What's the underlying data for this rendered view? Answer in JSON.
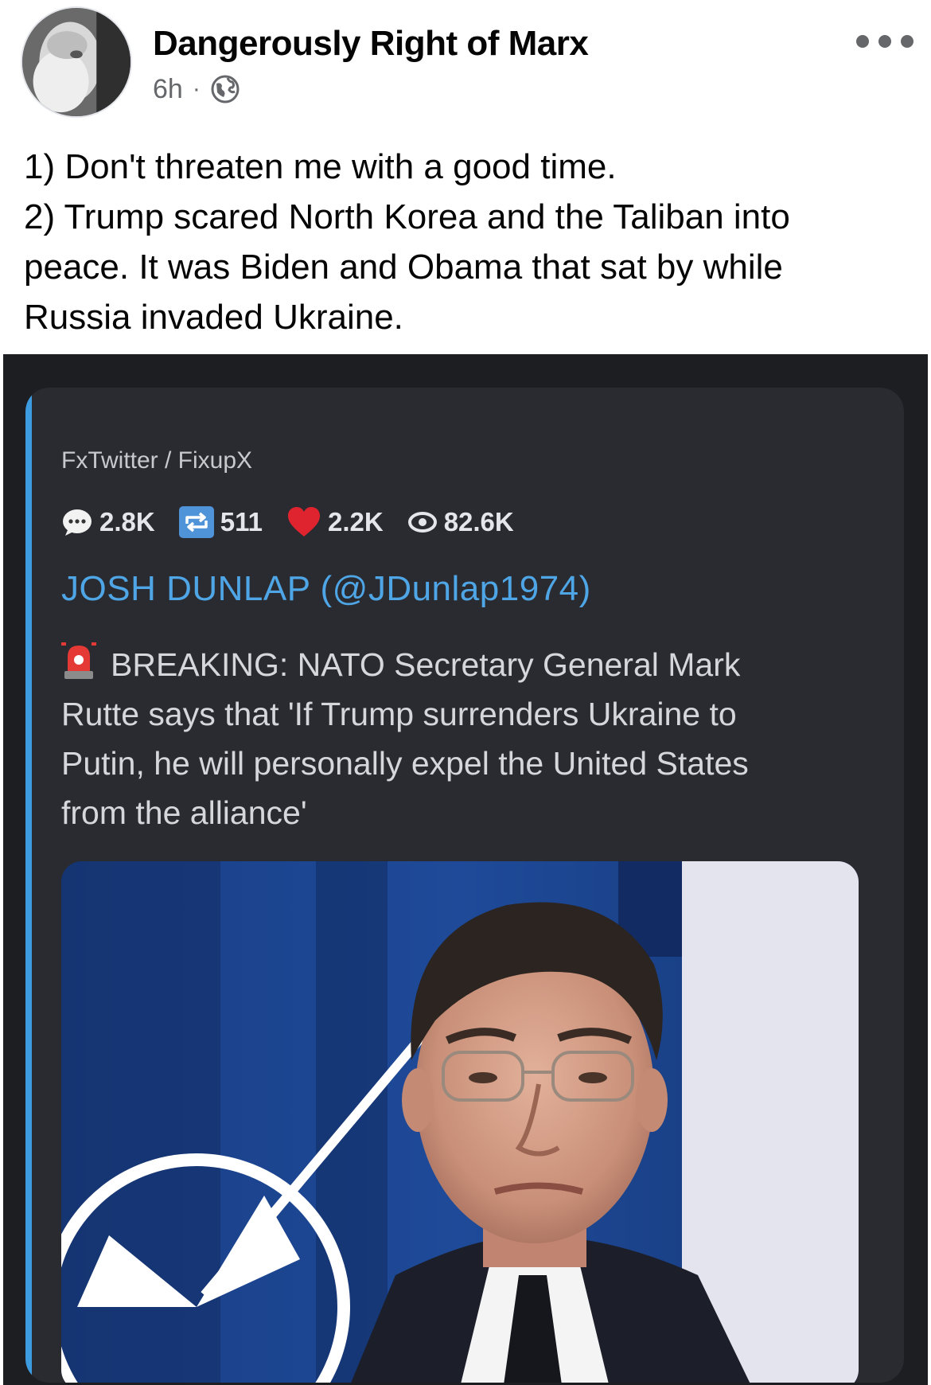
{
  "post": {
    "author": "Dangerously Right of Marx",
    "time": "6h",
    "separator": "·",
    "privacy_icon": "globe-icon",
    "more_icon": "more-options-icon",
    "text_lines": [
      "1) Don't threaten me with a good time.",
      "2) Trump scared North Korea and the Taliban into",
      "peace.  It was Biden and Obama that sat by while",
      "Russia invaded Ukraine."
    ]
  },
  "embed": {
    "provider": "FxTwitter / FixupX",
    "accent_color": "#3d9be0",
    "stats": {
      "replies": "2.8K",
      "retweets": "511",
      "likes": "2.2K",
      "views": "82.6K"
    },
    "author": "JOSH DUNLAP (@JDunlap1974)",
    "body_lines": [
      "BREAKING: NATO Secretary General Mark",
      "Rutte says that 'If Trump surrenders Ukraine to",
      "Putin, he will personally expel the United States",
      "from the alliance'"
    ],
    "body_prefix_icon": "siren-icon",
    "photo": "man-in-suit-before-nato-flag-photo"
  }
}
